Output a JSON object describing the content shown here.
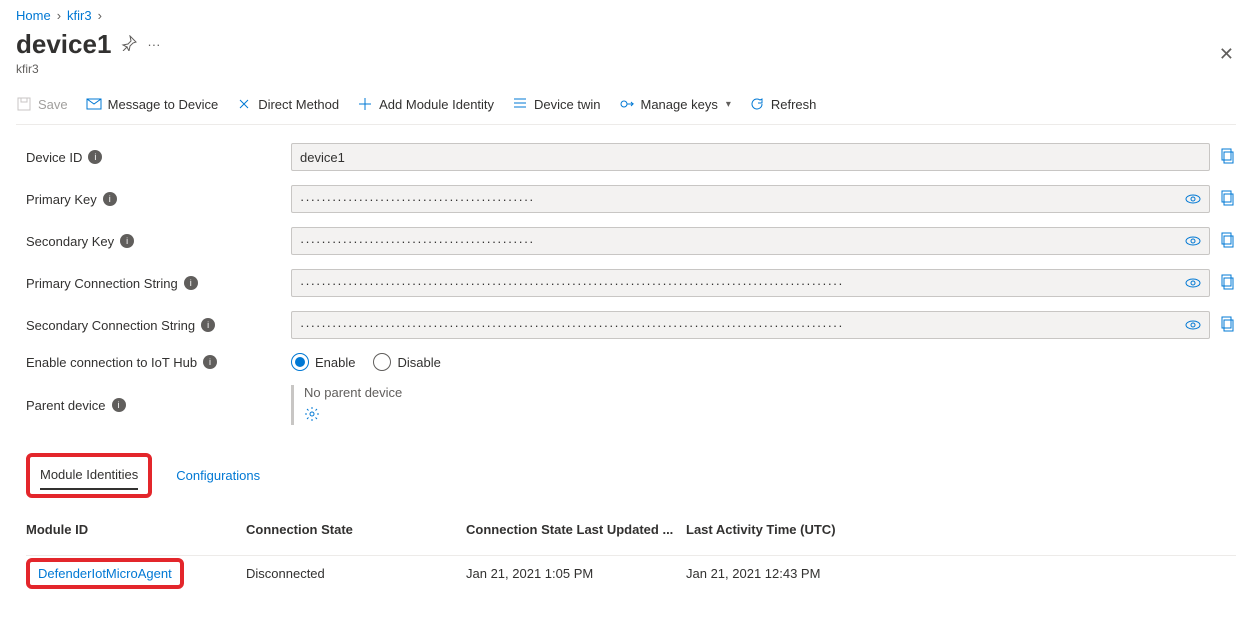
{
  "breadcrumb": {
    "home": "Home",
    "hub": "kfir3"
  },
  "header": {
    "title": "device1",
    "subtitle": "kfir3"
  },
  "toolbar": {
    "save": "Save",
    "message": "Message to Device",
    "direct": "Direct Method",
    "addModule": "Add Module Identity",
    "twin": "Device twin",
    "manageKeys": "Manage keys",
    "refresh": "Refresh"
  },
  "fields": {
    "deviceId_label": "Device ID",
    "deviceId_value": "device1",
    "primaryKey_label": "Primary Key",
    "primaryKey_value": "············································",
    "secondaryKey_label": "Secondary Key",
    "secondaryKey_value": "············································",
    "pcs_label": "Primary Connection String",
    "pcs_value": "······································································································",
    "scs_label": "Secondary Connection String",
    "scs_value": "······································································································",
    "enableConn_label": "Enable connection to IoT Hub",
    "enable": "Enable",
    "disable": "Disable",
    "parent_label": "Parent device",
    "parent_none": "No parent device"
  },
  "tabs": {
    "modules": "Module Identities",
    "configs": "Configurations"
  },
  "grid": {
    "col_moduleId": "Module ID",
    "col_connState": "Connection State",
    "col_lastUpdated": "Connection State Last Updated ...",
    "col_lastActivity": "Last Activity Time (UTC)",
    "rows": [
      {
        "moduleId": "DefenderIotMicroAgent",
        "connState": "Disconnected",
        "lastUpdated": "Jan 21, 2021 1:05 PM",
        "lastActivity": "Jan 21, 2021 12:43 PM"
      }
    ]
  }
}
